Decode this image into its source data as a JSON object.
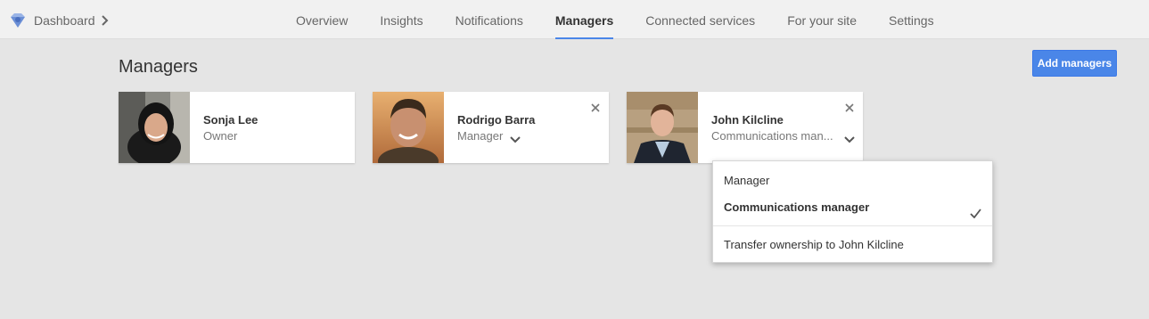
{
  "topbar": {
    "brand_label": "Dashboard",
    "tabs": [
      {
        "label": "Overview",
        "active": false
      },
      {
        "label": "Insights",
        "active": false
      },
      {
        "label": "Notifications",
        "active": false
      },
      {
        "label": "Managers",
        "active": true
      },
      {
        "label": "Connected services",
        "active": false
      },
      {
        "label": "For your site",
        "active": false
      },
      {
        "label": "Settings",
        "active": false
      }
    ]
  },
  "page": {
    "title": "Managers",
    "add_button": "Add managers"
  },
  "managers": [
    {
      "name": "Sonja Lee",
      "role": "Owner",
      "has_dropdown": false,
      "removable": false
    },
    {
      "name": "Rodrigo Barra",
      "role": "Manager",
      "has_dropdown": true,
      "removable": true
    },
    {
      "name": "John Kilcline",
      "role": "Communications man...",
      "has_dropdown": true,
      "removable": true
    }
  ],
  "role_menu": {
    "options": [
      {
        "label": "Manager",
        "selected": false
      },
      {
        "label": "Communications manager",
        "selected": true
      }
    ],
    "transfer_label": "Transfer ownership to John Kilcline"
  },
  "colors": {
    "accent": "#4a86e8",
    "page_bg": "#e5e5e5",
    "topbar_bg": "#f1f1f1"
  }
}
